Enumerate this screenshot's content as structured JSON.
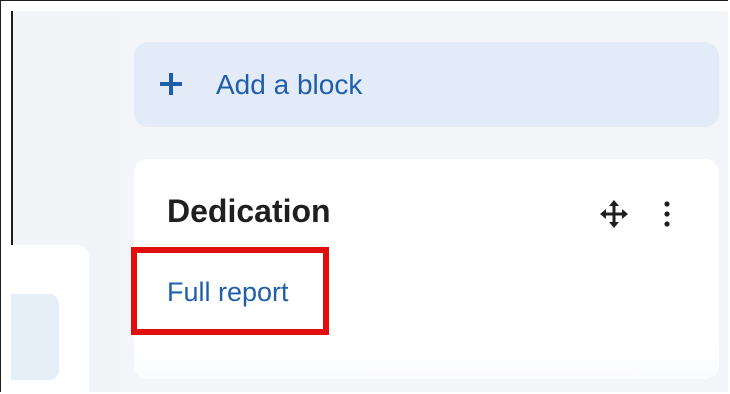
{
  "add_block": {
    "icon": "plus-icon",
    "label": "Add a block"
  },
  "block": {
    "title": "Dedication",
    "move_icon": "move-icon",
    "menu_icon": "kebab-menu-icon",
    "link_label": "Full report"
  },
  "colors": {
    "accent": "#1f5fa8",
    "highlight": "#e20d0d",
    "panel": "#f3f5f8",
    "add_block_bg": "#e2ebf7"
  }
}
